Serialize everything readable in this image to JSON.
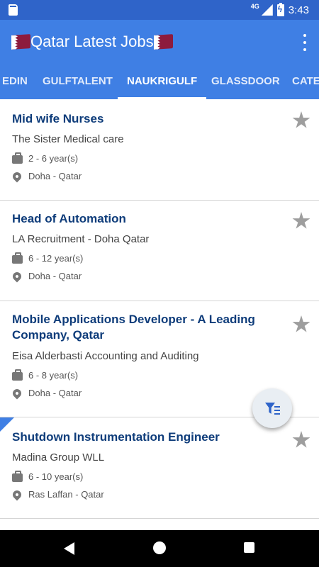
{
  "status_bar": {
    "network": "4G",
    "time": "3:43"
  },
  "app_bar": {
    "title": "Qatar Latest Jobs"
  },
  "tabs": [
    {
      "label": "EDIN",
      "active": false
    },
    {
      "label": "GULFTALENT",
      "active": false
    },
    {
      "label": "NAUKRIGULF",
      "active": true
    },
    {
      "label": "GLASSDOOR",
      "active": false
    },
    {
      "label": "CATE",
      "active": false
    }
  ],
  "jobs": [
    {
      "title": "Mid wife Nurses",
      "company": "The Sister Medical care",
      "experience": "2 - 6 year(s)",
      "location": "Doha - Qatar"
    },
    {
      "title": "Head of Automation",
      "company": "LA Recruitment - Doha Qatar",
      "experience": "6 - 12 year(s)",
      "location": "Doha - Qatar"
    },
    {
      "title": "Mobile Applications Developer - A Leading Company, Qatar",
      "company": "Eisa Alderbasti Accounting and Auditing",
      "experience": "6 - 8 year(s)",
      "location": "Doha - Qatar"
    },
    {
      "title": "Shutdown Instrumentation Engineer",
      "company": "Madina Group WLL",
      "experience": "6 - 10 year(s)",
      "location": "Ras Laffan - Qatar"
    }
  ],
  "icons": {
    "favorite": "star-icon",
    "experience": "briefcase-icon",
    "location": "location-pin-icon",
    "filter": "filter-icon",
    "menu": "more-vert-icon"
  },
  "colors": {
    "primary": "#3f7fe4",
    "status_bar": "#2f64c9",
    "job_title": "#0e3c7a"
  }
}
